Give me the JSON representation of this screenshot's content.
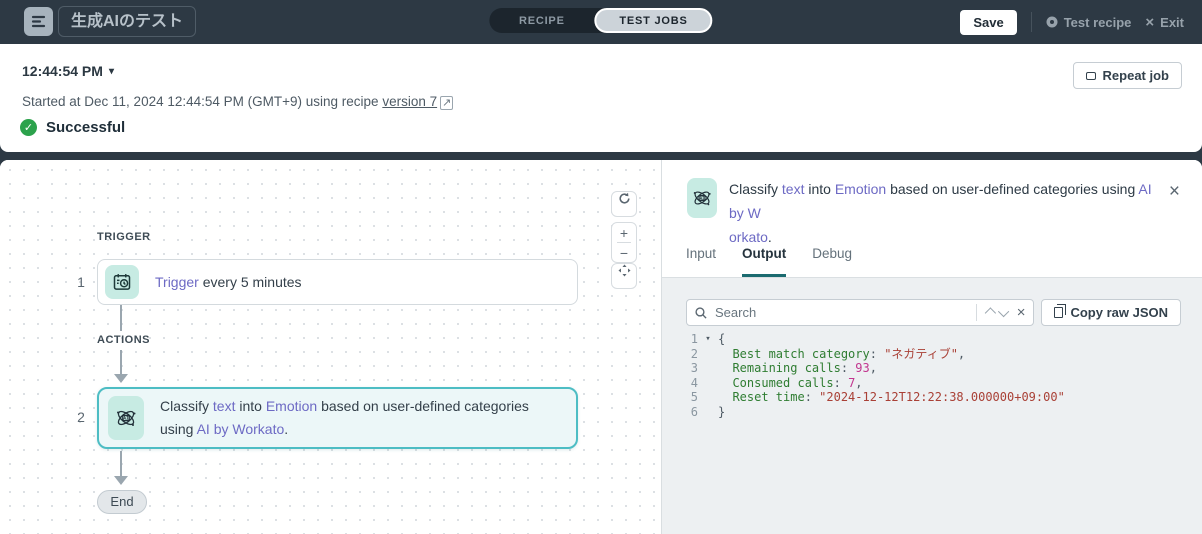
{
  "icons": {
    "caret_down": "▾",
    "check": "✓",
    "close": "×",
    "external": "↗",
    "fold": "▾",
    "zoom_in": "+",
    "zoom_out": "−"
  },
  "colors": {
    "header_bg": "#2d3944",
    "accent_teal": "#4dbdc4",
    "tab_underline": "#1b6b70",
    "success_green": "#2ca24c",
    "link_purple": "#6d6ac4",
    "code_key": "#2f7d32",
    "code_string": "#a94036",
    "code_number": "#c2368f"
  },
  "header": {
    "title": "生成AIのテスト",
    "toggle": {
      "recipe": "RECIPE",
      "test_jobs": "TEST JOBS"
    },
    "save_label": "Save",
    "test_recipe_label": "Test recipe",
    "exit_label": "Exit"
  },
  "job_header": {
    "time": "12:44:54 PM",
    "started_prefix": "Started at Dec 11, 2024 12:44:54 PM (GMT+9) using recipe ",
    "version_link": "version 7",
    "status": "Successful",
    "repeat_job_label": "Repeat job"
  },
  "canvas": {
    "trigger_label": "TRIGGER",
    "actions_label": "ACTIONS",
    "steps": [
      {
        "number": "1",
        "tokens": [
          {
            "text": "Trigger",
            "link": true
          },
          {
            "text": " every 5 minutes",
            "link": false
          }
        ]
      },
      {
        "number": "2",
        "tokens": [
          {
            "text": "Classify ",
            "link": false
          },
          {
            "text": "text",
            "link": true
          },
          {
            "text": " into ",
            "link": false
          },
          {
            "text": "Emotion",
            "link": true
          },
          {
            "text": " based on user-defined categories using ",
            "link": false
          },
          {
            "text": "AI by Workato",
            "link": true
          },
          {
            "text": ".",
            "link": false
          }
        ]
      }
    ],
    "end_label": "End"
  },
  "detail_panel": {
    "title_tokens": [
      {
        "text": "Classify ",
        "link": false
      },
      {
        "text": "text",
        "link": true
      },
      {
        "text": " into ",
        "link": false
      },
      {
        "text": "Emotion",
        "link": true
      },
      {
        "text": " based on user-defined categories using ",
        "link": false
      },
      {
        "text": "AI by W",
        "link": true
      },
      {
        "br": true
      },
      {
        "text": "orkato",
        "link": true
      },
      {
        "text": ".",
        "link": false
      }
    ],
    "tabs": [
      {
        "label": "Input"
      },
      {
        "label": "Output"
      },
      {
        "label": "Debug"
      }
    ],
    "search_placeholder": "Search",
    "copy_button_label": "Copy raw JSON",
    "code": {
      "lines": [
        {
          "num": "1",
          "fold": true,
          "tokens": [
            {
              "t": "punct",
              "v": "{"
            }
          ]
        },
        {
          "num": "2",
          "tokens": [
            {
              "t": "punct",
              "v": "  "
            },
            {
              "t": "key",
              "v": "Best match category"
            },
            {
              "t": "punct",
              "v": ": "
            },
            {
              "t": "str",
              "v": "\"ネガティブ\""
            },
            {
              "t": "punct",
              "v": ","
            }
          ]
        },
        {
          "num": "3",
          "tokens": [
            {
              "t": "punct",
              "v": "  "
            },
            {
              "t": "key",
              "v": "Remaining calls"
            },
            {
              "t": "punct",
              "v": ": "
            },
            {
              "t": "num",
              "v": "93"
            },
            {
              "t": "punct",
              "v": ","
            }
          ]
        },
        {
          "num": "4",
          "tokens": [
            {
              "t": "punct",
              "v": "  "
            },
            {
              "t": "key",
              "v": "Consumed calls"
            },
            {
              "t": "punct",
              "v": ": "
            },
            {
              "t": "num",
              "v": "7"
            },
            {
              "t": "punct",
              "v": ","
            }
          ]
        },
        {
          "num": "5",
          "tokens": [
            {
              "t": "punct",
              "v": "  "
            },
            {
              "t": "key",
              "v": "Reset time"
            },
            {
              "t": "punct",
              "v": ": "
            },
            {
              "t": "str",
              "v": "\"2024-12-12T12:22:38.000000+09:00\""
            }
          ]
        },
        {
          "num": "6",
          "tokens": [
            {
              "t": "punct",
              "v": "}"
            }
          ]
        }
      ]
    }
  }
}
